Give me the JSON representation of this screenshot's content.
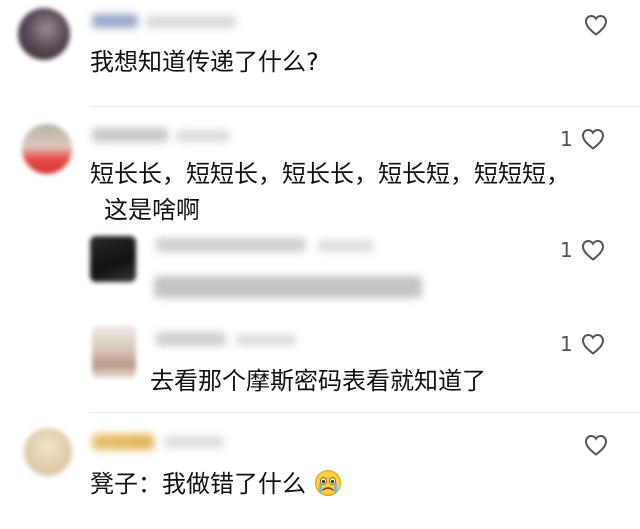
{
  "comments": [
    {
      "text": "我想知道传递了什么?",
      "like_count": ""
    },
    {
      "text_line1": "短长长，短短长，短长长，短长短，短短短，",
      "text_line2": "这是啥啊",
      "like_count": "1",
      "replies": [
        {
          "like_count": "1"
        },
        {
          "text": "去看那个摩斯密码表看就知道了",
          "like_count": "1"
        }
      ]
    },
    {
      "text": "凳子：我做错了什么",
      "emoji": "crying-face-emoji",
      "like_count": ""
    }
  ],
  "colors": {
    "text": "#111111",
    "like_count": "#555555",
    "heart_outline": "#555555",
    "blur_gray": "#cfcfcf"
  }
}
